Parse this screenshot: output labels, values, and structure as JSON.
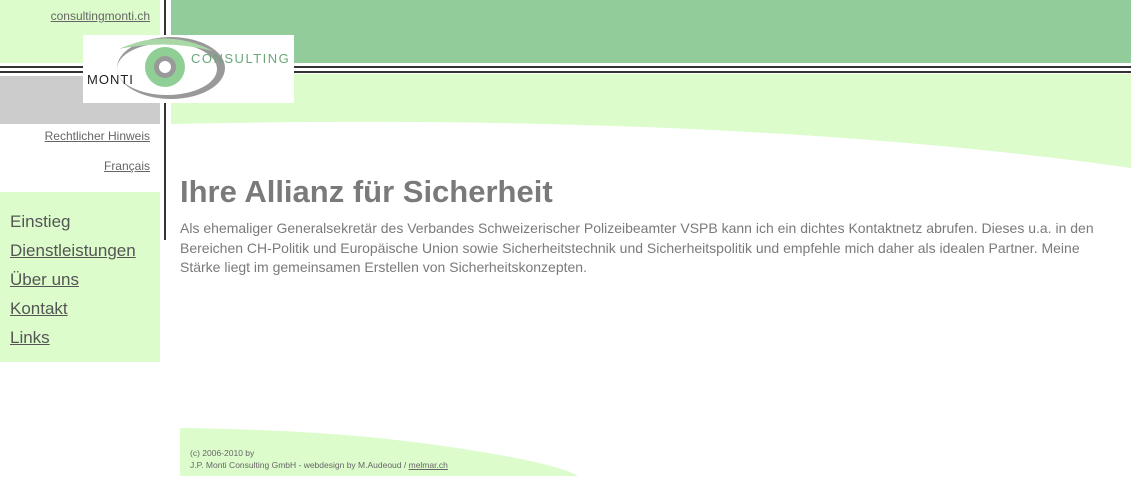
{
  "header": {
    "domain_link": "consultingmonti.ch",
    "logo": {
      "word_left": "MONTI",
      "word_right": "CONSULTING"
    },
    "legal_link": "Rechtlicher Hinweis",
    "language_link": "Français"
  },
  "nav": {
    "items": [
      {
        "label": "Einstieg",
        "current": true
      },
      {
        "label": "Dienstleistungen",
        "current": false
      },
      {
        "label": "Über uns",
        "current": false
      },
      {
        "label": "Kontakt",
        "current": false
      },
      {
        "label": "Links",
        "current": false
      }
    ]
  },
  "main": {
    "title": "Ihre Allianz für Sicherheit",
    "intro": "Als ehemaliger Generalsekretär des Verbandes Schweizerischer Polizeibeamter VSPB kann ich ein dichtes Kontaktnetz abrufen. Dieses u.a. in den Bereichen CH-Politik und Europäische Union sowie Sicherheitstechnik und Sicherheitspolitik und empfehle mich daher als idealen Partner. Meine Stärke liegt im gemeinsamen Erstellen von Sicherheitskonzepten."
  },
  "footer": {
    "copyright": "(c) 2006-2010 by",
    "credits": "J.P. Monti Consulting GmbH - webdesign by M.Audeoud /",
    "designer_link": "melmar.ch"
  },
  "colors": {
    "light_green": "#ddfccc",
    "header_green": "#92cc9a",
    "gray": "#cccccc",
    "text_gray": "#7a7a7a"
  }
}
